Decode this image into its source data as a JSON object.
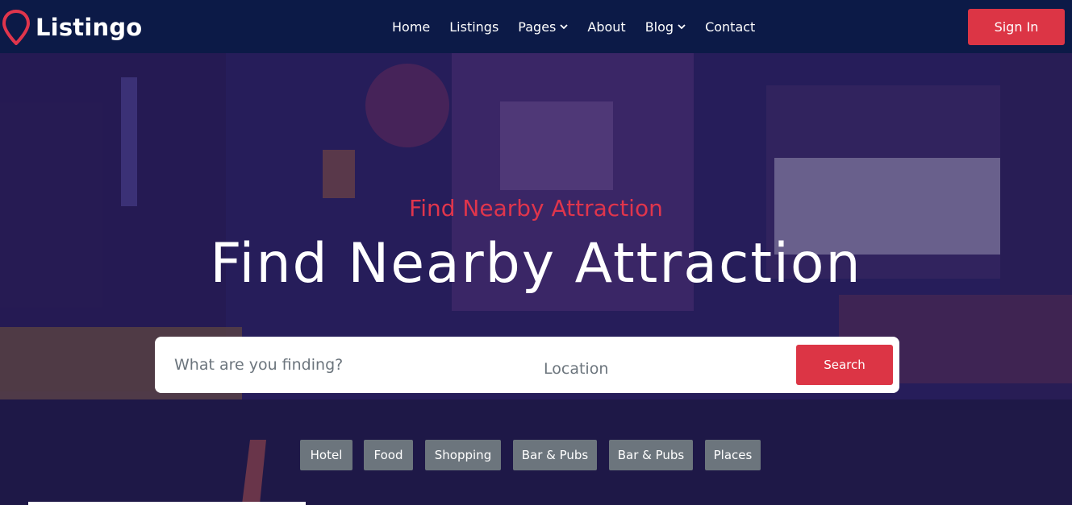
{
  "brand": {
    "name": "Listingo",
    "accent": "#e0354c"
  },
  "nav": {
    "items": [
      {
        "label": "Home",
        "dropdown": false
      },
      {
        "label": "Listings",
        "dropdown": false
      },
      {
        "label": "Pages",
        "dropdown": true
      },
      {
        "label": "About",
        "dropdown": false
      },
      {
        "label": "Blog",
        "dropdown": true
      },
      {
        "label": "Contact",
        "dropdown": false
      }
    ],
    "sign_in": "Sign In"
  },
  "hero": {
    "subtitle": "Find Nearby Attraction",
    "title": "Find Nearby Attraction"
  },
  "search": {
    "what_placeholder": "What are you finding?",
    "location_placeholder": "Location",
    "button": "Search"
  },
  "tags": [
    "Hotel",
    "Food",
    "Shopping",
    "Bar & Pubs",
    "Bar & Pubs",
    "Places"
  ],
  "colors": {
    "navbar": "#0c1a47",
    "primary": "#dc3545",
    "tag": "#6c757d"
  }
}
